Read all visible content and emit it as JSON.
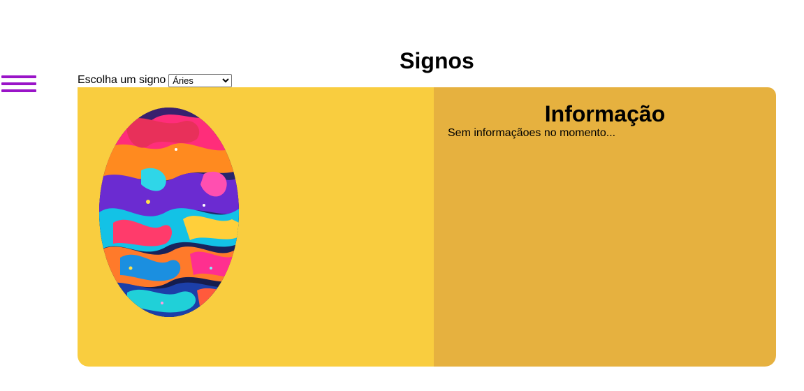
{
  "menu": {
    "icon": "hamburger-menu-icon",
    "color": "#9a14c8"
  },
  "page": {
    "title": "Signos"
  },
  "selector": {
    "label": "Escolha um signo",
    "selected": "Áries"
  },
  "card": {
    "image_panel_color": "#f9cd3f",
    "info_panel_color": "#e6b13f",
    "image": {
      "name": "abstract-colorful-fluid-art"
    },
    "info": {
      "title": "Informação",
      "text": "Sem informaçãoes no momento..."
    }
  }
}
